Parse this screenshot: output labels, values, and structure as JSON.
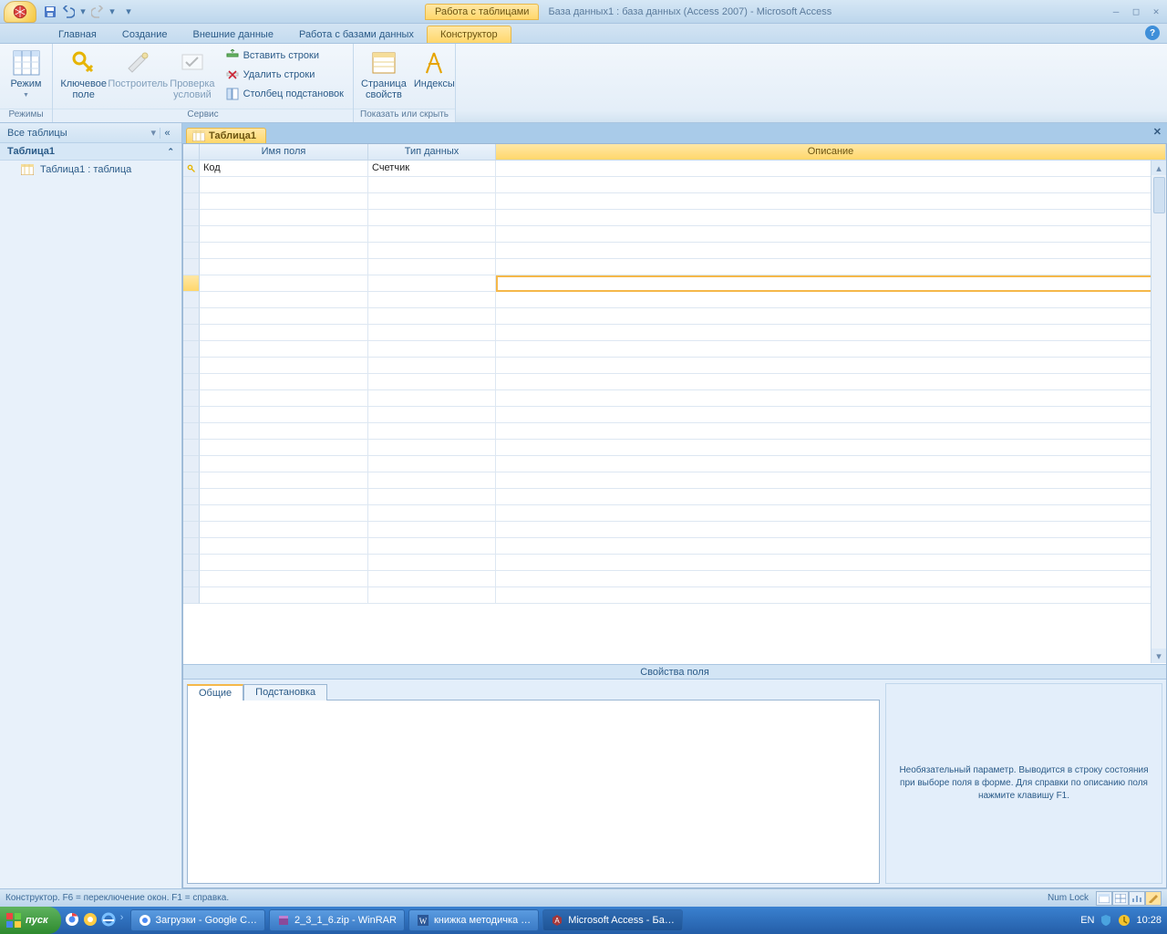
{
  "title": {
    "context_tab": "Работа с таблицами",
    "window": "База данных1 : база данных (Access 2007) - Microsoft Access"
  },
  "ribbon_tabs": {
    "home": "Главная",
    "create": "Создание",
    "external": "Внешние данные",
    "dbtools": "Работа с базами данных",
    "design": "Конструктор"
  },
  "ribbon": {
    "views_group": "Режимы",
    "view_btn": "Режим",
    "tools_group": "Сервис",
    "primary_key": "Ключевое поле",
    "builder": "Построитель",
    "test_rules": "Проверка условий",
    "insert_rows": "Вставить строки",
    "delete_rows": "Удалить строки",
    "lookup_col": "Столбец  подстановок",
    "showhide_group": "Показать или скрыть",
    "prop_sheet": "Страница свойств",
    "indexes": "Индексы"
  },
  "nav": {
    "header": "Все таблицы",
    "group": "Таблица1",
    "item1": "Таблица1 : таблица"
  },
  "doc": {
    "tab": "Таблица1"
  },
  "grid": {
    "col_name": "Имя поля",
    "col_type": "Тип данных",
    "col_desc": "Описание",
    "row1_name": "Код",
    "row1_type": "Счетчик"
  },
  "props": {
    "split_label": "Свойства поля",
    "tab_general": "Общие",
    "tab_lookup": "Подстановка",
    "help_text": "Необязательный параметр.  Выводится в строку состояния при выборе поля в форме.  Для справки по описанию поля нажмите клавишу F1."
  },
  "status": {
    "left": "Конструктор.  F6 = переключение окон.  F1 = справка.",
    "numlock": "Num Lock"
  },
  "taskbar": {
    "start": "пуск",
    "t1": "Загрузки - Google C…",
    "t2": "2_3_1_6.zip - WinRAR",
    "t3": "книжка методичка …",
    "t4": "Microsoft Access - Ба…",
    "lang": "EN",
    "clock": "10:28"
  }
}
